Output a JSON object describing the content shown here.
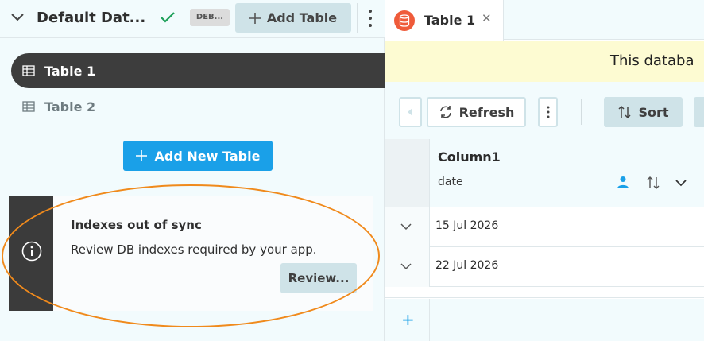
{
  "left_header": {
    "datasource_name": "Default Dat...",
    "env_badge": "DEB...",
    "add_table_label": "Add Table"
  },
  "tables": [
    {
      "name": "Table 1",
      "active": true
    },
    {
      "name": "Table 2",
      "active": false
    }
  ],
  "add_new_table_label": "Add New Table",
  "sync_card": {
    "title": "Indexes out of sync",
    "message": "Review DB indexes required by your app.",
    "review_label": "Review..."
  },
  "tab": {
    "label": "Table 1",
    "close_glyph": "✕"
  },
  "banner": {
    "text": "This databa"
  },
  "toolbar": {
    "refresh_label": "Refresh",
    "sort_label": "Sort"
  },
  "grid": {
    "column": {
      "name": "Column1",
      "type": "date"
    },
    "rows": [
      {
        "value": "15 Jul 2026"
      },
      {
        "value": "22 Jul 2026"
      }
    ],
    "add_row_glyph": "+"
  },
  "colors": {
    "accent": "#1aa0e8",
    "success": "#1ea05a",
    "highlight": "#f08a1c",
    "db_icon": "#ef5b3a",
    "banner": "#fdfbd2"
  }
}
